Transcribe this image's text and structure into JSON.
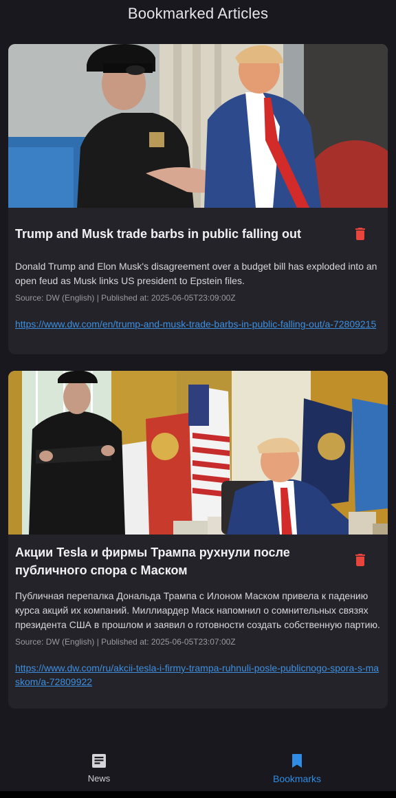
{
  "header": {
    "title": "Bookmarked Articles"
  },
  "articles": [
    {
      "image_alt": "Elon Musk in black cap and sunglasses with Donald Trump in blue suit and red tie",
      "title": "Trump and Musk trade barbs in public falling out",
      "description": "Donald Trump and Elon Musk's disagreement over a budget bill has exploded into an open feud as Musk links US president to Epstein files.",
      "meta": "Source: DW (English) | Published at: 2025-06-05T23:09:00Z",
      "url": "https://www.dw.com/en/trump-and-musk-trade-barbs-in-public-falling-out/a-72809215"
    },
    {
      "image_alt": "Elon Musk standing with arms crossed while Donald Trump sits at desk in the Oval Office with flags",
      "title": "Акции Tesla и фирмы Трампа рухнули после публичного спора с Маском",
      "description": "Публичная перепалка Дональда Трампа с Илоном Маском привела к падению курса акций их компаний. Миллиардер Маск напомнил о сомнительных связях президента США в прошлом и заявил о готовности создать собственную партию.",
      "meta": "Source: DW (English) | Published at: 2025-06-05T23:07:00Z",
      "url": "https://www.dw.com/ru/akcii-tesla-i-firmy-trampa-ruhnuli-posle-publicnogo-spora-s-maskom/a-72809922"
    }
  ],
  "nav": {
    "items": [
      {
        "label": "News",
        "icon": "newspaper-icon",
        "active": false
      },
      {
        "label": "Bookmarks",
        "icon": "bookmark-icon",
        "active": true
      }
    ]
  },
  "colors": {
    "background": "#19181e",
    "card": "#242329",
    "delete_icon": "#e8453c",
    "link": "#3d8fe0",
    "active_nav": "#2f8de4"
  }
}
